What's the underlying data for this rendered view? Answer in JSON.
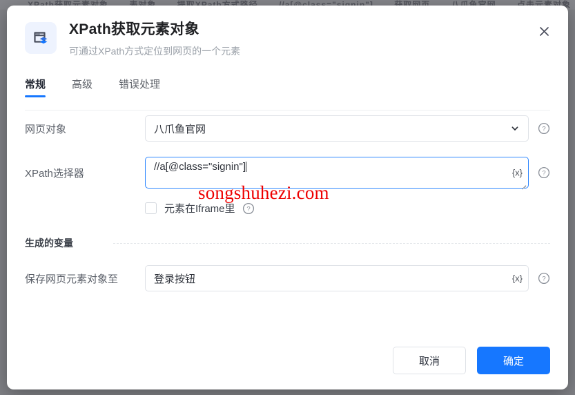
{
  "background": {
    "toolbar_items": [
      "XPath获取元素对象",
      "表对象",
      "提取XPath方式路径",
      "//a[@class=\"signin\"]",
      "获取网页",
      "八爪鱼官网",
      "点击元素对象"
    ]
  },
  "dialog": {
    "icon": "web-element-layers-icon",
    "title": "XPath获取元素对象",
    "subtitle": "可通过XPath方式定位到网页的一个元素",
    "close_label": "✕",
    "tabs": [
      {
        "label": "常规",
        "active": true
      },
      {
        "label": "高级",
        "active": false
      },
      {
        "label": "错误处理",
        "active": false
      }
    ],
    "fields": {
      "web_object": {
        "label": "网页对象",
        "value": "八爪鱼官网",
        "control": "select",
        "help": "?"
      },
      "xpath_selector": {
        "label": "XPath选择器",
        "value": "//a[@class=\"signin\"]",
        "control": "textarea",
        "variable_button": "{x}",
        "help": "?"
      },
      "iframe_checkbox": {
        "label": "元素在Iframe里",
        "checked": false,
        "help": "?"
      }
    },
    "variable_section": {
      "title": "生成的变量",
      "save_to": {
        "label": "保存网页元素对象至",
        "value": "登录按钮",
        "variable_button": "{x}",
        "help": "?"
      }
    },
    "footer": {
      "cancel_label": "取消",
      "confirm_label": "确定"
    }
  },
  "watermark": {
    "text": "songshuhezi.com",
    "color": "#ee0000"
  },
  "theme": {
    "accent": "#1677ff",
    "focus_border": "#2d86ff",
    "text_primary": "#202124",
    "text_secondary": "#9aa0a8",
    "backdrop": "#8a8a8e"
  }
}
